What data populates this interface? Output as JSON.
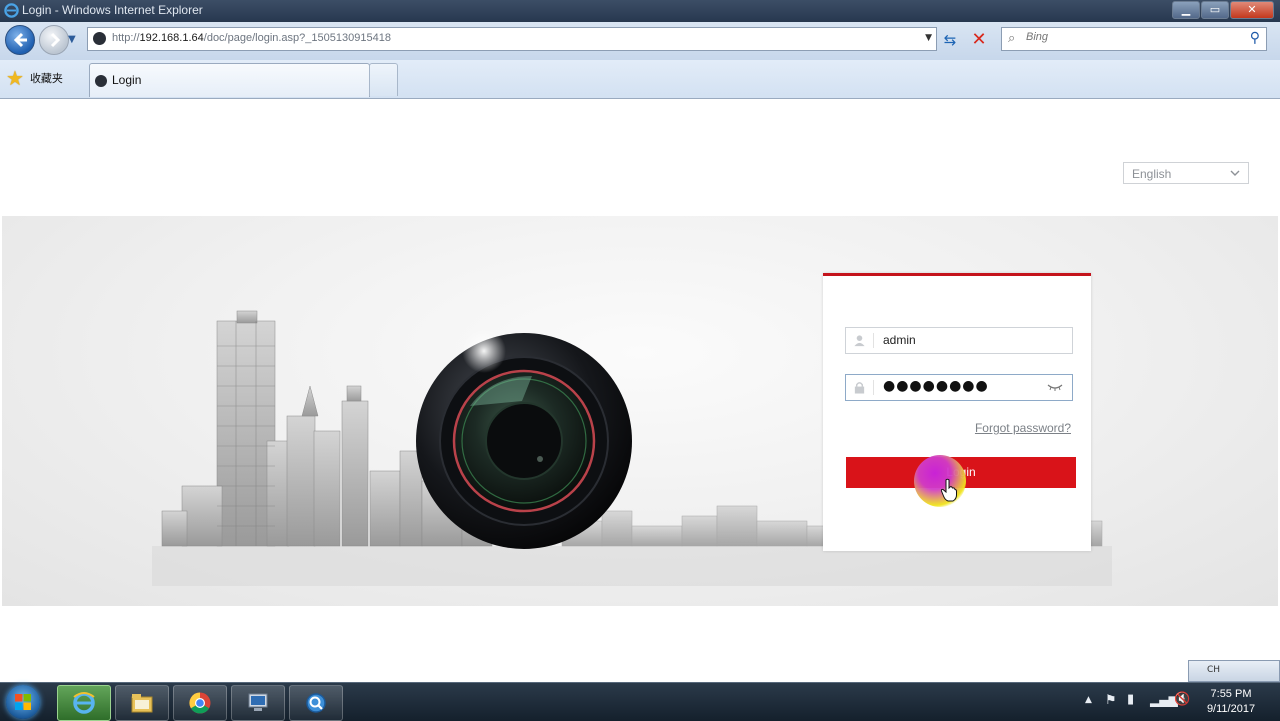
{
  "window": {
    "title": "Login - Windows Internet Explorer",
    "controls": {
      "minimize": "▁",
      "maximize": "▭",
      "close": "✕"
    }
  },
  "address_bar": {
    "url_prefix": "http://",
    "url_host": "192.168.1.64",
    "url_path": "/doc/page/login.asp?_1505130915418",
    "search_placeholder": "Bing"
  },
  "favorites": {
    "label": "收藏夹"
  },
  "tabs": [
    {
      "label": "Login"
    }
  ],
  "page": {
    "language_select": "English",
    "login": {
      "username": "admin",
      "password_mask": "●●●●●●●●",
      "forgot_password": "Forgot password?",
      "login_button": "Login"
    }
  },
  "taskbar": {
    "clock_time": "7:55 PM",
    "clock_date": "9/11/2017",
    "language_indicator": "CH"
  },
  "colors": {
    "accent_red": "#d91319",
    "login_top_border": "#c4131b"
  }
}
